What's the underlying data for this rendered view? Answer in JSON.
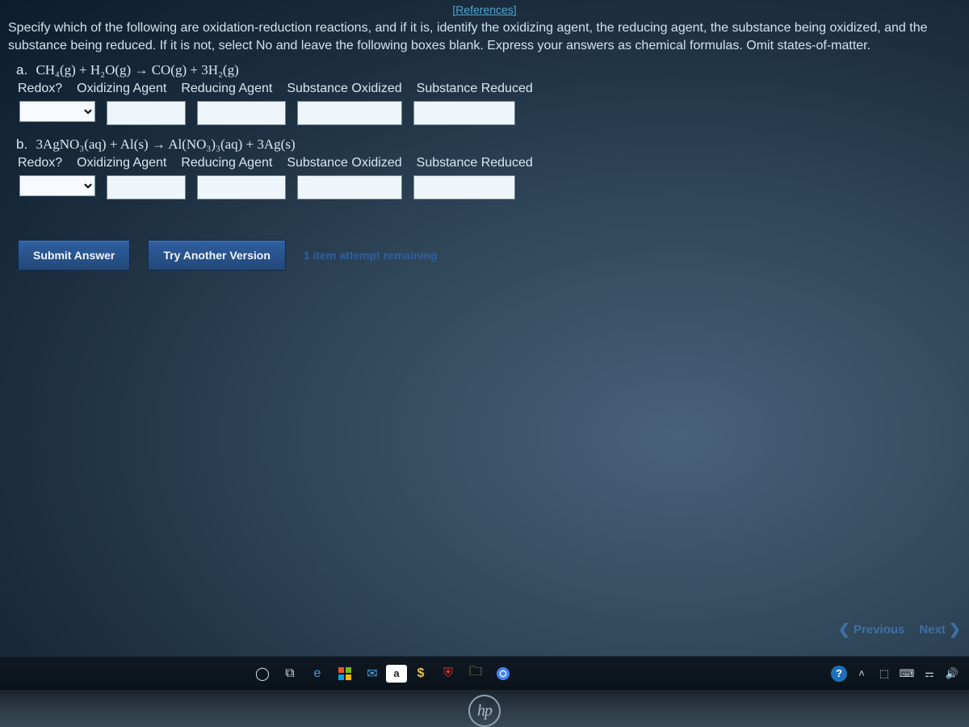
{
  "references_label": "[References]",
  "instructions": "Specify which of the following are oxidation-reduction reactions, and if it is, identify the oxidizing agent, the reducing agent, the substance being oxidized, and the substance being reduced. If it is not, select No and leave the following boxes blank. Express your answers as chemical formulas. Omit states-of-matter.",
  "columns": {
    "redox": "Redox?",
    "oxidizing": "Oxidizing Agent",
    "reducing": "Reducing Agent",
    "sub_ox": "Substance Oxidized",
    "sub_red": "Substance Reduced"
  },
  "questions": {
    "a": {
      "label": "a.",
      "equation_html": "CH₄(g) + H₂O(g) → CO(g) + 3H₂(g)"
    },
    "b": {
      "label": "b.",
      "equation_html": "3AgNO₃(aq) + Al(s) → Al(NO₃)₃(aq) + 3Ag(s)"
    }
  },
  "buttons": {
    "submit": "Submit Answer",
    "try_another": "Try Another Version"
  },
  "attempts_text": "1 item attempt remaining",
  "nav": {
    "previous": "Previous",
    "next": "Next"
  },
  "taskbar": {
    "icons": [
      "windows-icon",
      "task-view-icon",
      "edge-icon",
      "store-icon",
      "mail-icon",
      "amazon-icon",
      "dollar-icon",
      "shield-icon",
      "file-explorer-icon",
      "chrome-icon"
    ]
  },
  "tray": {
    "help": "?",
    "items": [
      "caret-up-icon",
      "dropbox-icon",
      "keyboard-icon",
      "wifi-icon",
      "volume-icon"
    ]
  },
  "hp_logo_text": "hp"
}
